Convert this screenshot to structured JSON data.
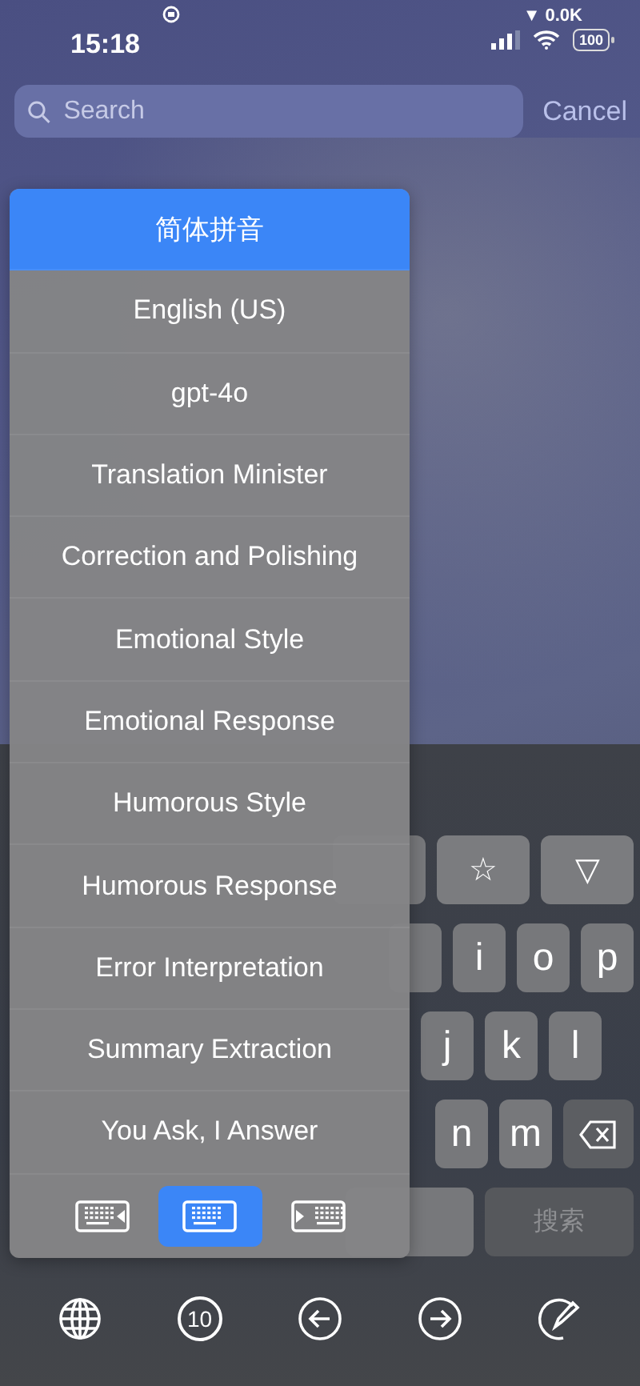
{
  "status_bar": {
    "time": "15:18",
    "network_speed": "▼ 0.0K",
    "battery": "100"
  },
  "search": {
    "placeholder": "Search",
    "cancel": "Cancel"
  },
  "input_menu": {
    "items": [
      {
        "label": "简体拼音",
        "selected": true
      },
      {
        "label": "English (US)",
        "selected": false
      },
      {
        "label": "gpt-4o",
        "selected": false
      },
      {
        "label": "Translation Minister",
        "selected": false
      },
      {
        "label": "Correction and Polishing",
        "selected": false
      },
      {
        "label": "Emotional Style",
        "selected": false
      },
      {
        "label": "Emotional Response",
        "selected": false
      },
      {
        "label": "Humorous Style",
        "selected": false
      },
      {
        "label": "Humorous Response",
        "selected": false
      },
      {
        "label": "Error Interpretation",
        "selected": false
      },
      {
        "label": "Summary Extraction",
        "selected": false
      },
      {
        "label": "You Ask, I Answer",
        "selected": false
      }
    ],
    "keyboard_modes": [
      {
        "kind": "left",
        "selected": false
      },
      {
        "kind": "full",
        "selected": true
      },
      {
        "kind": "right",
        "selected": false
      }
    ]
  },
  "keyboard": {
    "rows": [
      [
        {
          "kind": "blank"
        },
        {
          "kind": "char",
          "label": "☆"
        },
        {
          "kind": "char",
          "label": "▽"
        }
      ],
      [
        {
          "kind": "blank"
        },
        {
          "kind": "char",
          "label": "i"
        },
        {
          "kind": "char",
          "label": "o"
        },
        {
          "kind": "char",
          "label": "p"
        }
      ],
      [
        {
          "kind": "char",
          "label": "j"
        },
        {
          "kind": "char",
          "label": "k"
        },
        {
          "kind": "char",
          "label": "l"
        }
      ],
      [
        {
          "kind": "char",
          "label": "n"
        },
        {
          "kind": "char",
          "label": "m"
        },
        {
          "kind": "delete"
        }
      ],
      [
        {
          "kind": "blank"
        },
        {
          "kind": "action",
          "label": "搜索"
        }
      ]
    ]
  },
  "toolbar": [
    {
      "kind": "globe"
    },
    {
      "kind": "number",
      "label": "10"
    },
    {
      "kind": "back"
    },
    {
      "kind": "forward"
    },
    {
      "kind": "pen"
    }
  ]
}
